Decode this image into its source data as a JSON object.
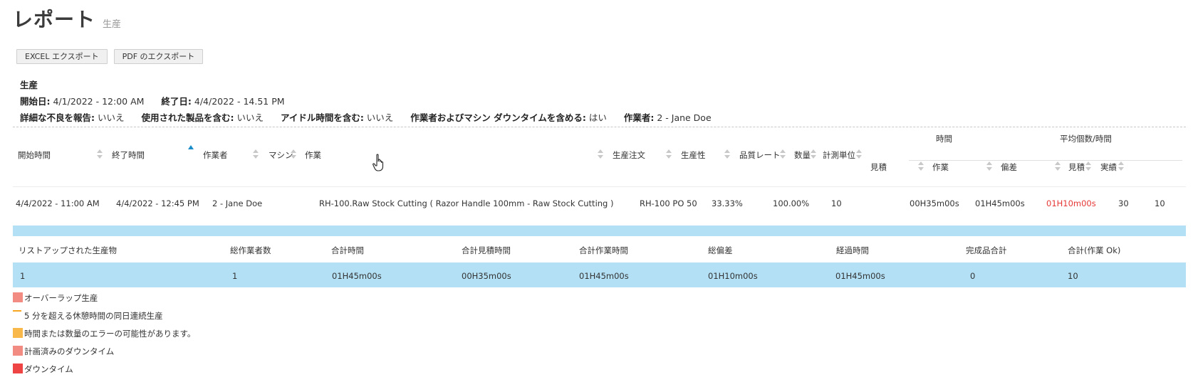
{
  "header": {
    "title": "レポート",
    "subtitle": "生産"
  },
  "buttons": {
    "excel": "EXCEL エクスポート",
    "pdf": "PDF のエクスポート"
  },
  "report": {
    "name": "生産",
    "start_label": "開始日:",
    "start_value": "4/1/2022 - 12:00 AM",
    "end_label": "終了日:",
    "end_value": "4/4/2022 - 14.51 PM",
    "defect_label": "詳細な不良を報告:",
    "defect_value": "いいえ",
    "products_label": "使用された製品を含む:",
    "products_value": "いいえ",
    "idle_label": "アイドル時間を含む:",
    "idle_value": "いいえ",
    "downtime_label": "作業者およびマシン ダウンタイムを含める:",
    "downtime_value": "はい",
    "operator_label": "作業者:",
    "operator_value": "2 - Jane Doe"
  },
  "table": {
    "group_time": "時間",
    "group_avg": "平均個数/時間",
    "headers": {
      "start": "開始時間",
      "end": "終了時間",
      "operator": "作業者",
      "machine": "マシン",
      "job": "作業",
      "order": "生産注文",
      "productivity": "生産性",
      "quality": "品質レート",
      "qty": "数量",
      "unit": "計測単位",
      "t_est": "見積",
      "t_work": "作業",
      "t_dev": "偏差",
      "a_est": "見積",
      "a_act": "実績"
    },
    "row": {
      "start": "4/4/2022 - 11:00 AM",
      "end": "4/4/2022 - 12:45 PM",
      "operator": "2 - Jane Doe",
      "job": "RH-100.Raw Stock Cutting ( Razor Handle 100mm - Raw Stock Cutting )",
      "order": "RH-100 PO 50",
      "productivity": "33.33%",
      "quality": "100.00%",
      "qty": "10",
      "t_est": "00H35m00s",
      "t_work": "01H45m00s",
      "t_dev": "01H10m00s",
      "a_est": "30",
      "a_act": "10"
    }
  },
  "summary": {
    "headers": {
      "listed": "リストアップされた生産物",
      "operators": "総作業者数",
      "total_time": "合計時間",
      "total_est": "合計見積時間",
      "total_work": "合計作業時間",
      "total_dev": "総偏差",
      "elapsed": "経過時間",
      "finished": "完成品合計",
      "total_ok": "合計(作業 Ok)"
    },
    "values": {
      "listed": "1",
      "operators": "1",
      "total_time": "01H45m00s",
      "total_est": "00H35m00s",
      "total_work": "01H45m00s",
      "total_dev": "01H10m00s",
      "elapsed": "01H45m00s",
      "finished": "0",
      "total_ok": "10"
    }
  },
  "legend": [
    {
      "label": "オーバーラップ生産",
      "color": "#f28b82"
    },
    {
      "label": "5 分を超える休憩時間の同日連続生産",
      "color": "#f6a623"
    },
    {
      "label": "時間または数量のエラーの可能性があります。",
      "color": "#f9b84a"
    },
    {
      "label": "計画済みのダウンタイム",
      "color": "#f28b82"
    },
    {
      "label": "ダウンタイム",
      "color": "#ef4444"
    }
  ],
  "colors": {
    "highlight": "#b3e0f5",
    "deviation": "#e53935",
    "sort_active": "#1a8dc9"
  },
  "icons": {
    "cursor": "hand-pointer-icon",
    "sort": "sort-arrows-icon"
  }
}
